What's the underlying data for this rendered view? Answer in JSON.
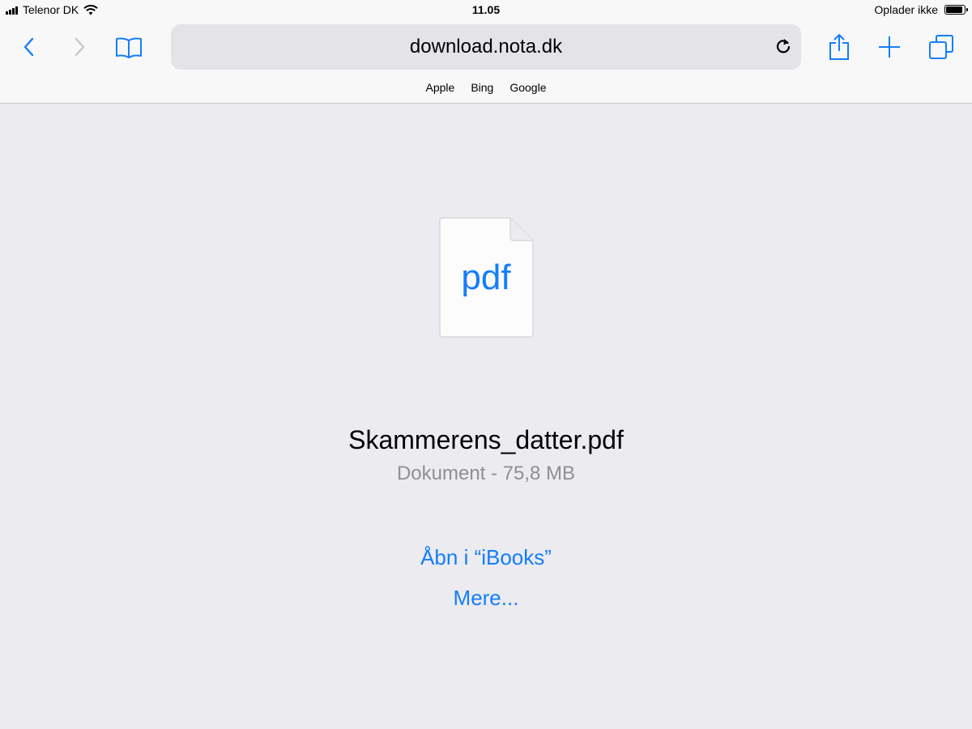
{
  "status_bar": {
    "carrier": "Telenor DK",
    "time": "11.05",
    "charging_status": "Oplader ikke",
    "battery_level": 0.92,
    "signal_icon": "cellular-signal-icon",
    "wifi_icon": "wifi-icon",
    "battery_icon": "battery-icon"
  },
  "toolbar": {
    "back_icon": "chevron-left-icon",
    "forward_icon": "chevron-right-icon",
    "bookmarks_icon": "open-book-icon",
    "url": "download.nota.dk",
    "reload_icon": "reload-icon",
    "share_icon": "share-icon",
    "new_tab_icon": "plus-icon",
    "tabs_icon": "tabs-icon"
  },
  "favorites": [
    "Apple",
    "Bing",
    "Google"
  ],
  "download": {
    "file_type_label": "pdf",
    "filename": "Skammerens_datter.pdf",
    "file_info": "Dokument - 75,8 MB",
    "open_in_label": "Åbn i “iBooks”",
    "more_label": "Mere..."
  },
  "colors": {
    "accent": "#147efb",
    "background": "#ebebf0",
    "toolbar": "#f8f8f8",
    "secondary_text": "#8e8e93"
  }
}
